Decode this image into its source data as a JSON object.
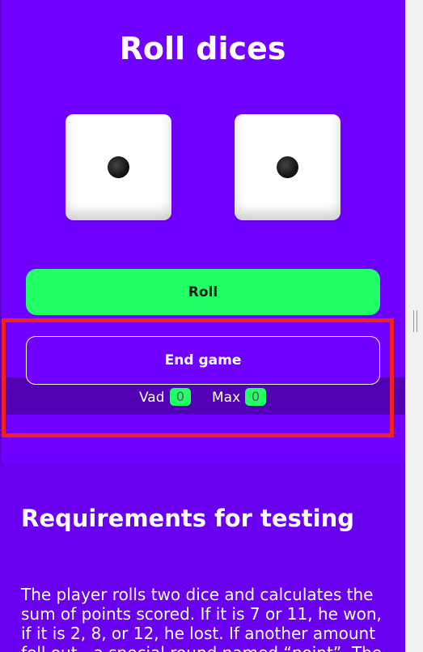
{
  "header": {
    "title": "Roll dices"
  },
  "dice": [
    {
      "value": 1,
      "pip_icon": "die-pip-icon"
    },
    {
      "value": 1,
      "pip_icon": "die-pip-icon"
    }
  ],
  "controls": {
    "roll_label": "Roll",
    "end_label": "End game"
  },
  "scores": [
    {
      "label": "Vad",
      "value": "0"
    },
    {
      "label": "Max",
      "value": "0"
    }
  ],
  "requirements": {
    "title": "Requirements for testing",
    "text": "The player rolls two dice and calculates the sum of points scored. If it is 7 or 11, he won, if it is 2, 8, or 12, he lost. If another amount fell out - a special round named “point”. The"
  },
  "colors": {
    "background": "#7000ff",
    "accent": "#22ff66",
    "band": "#5200b4",
    "highlight": "#ee2222"
  }
}
